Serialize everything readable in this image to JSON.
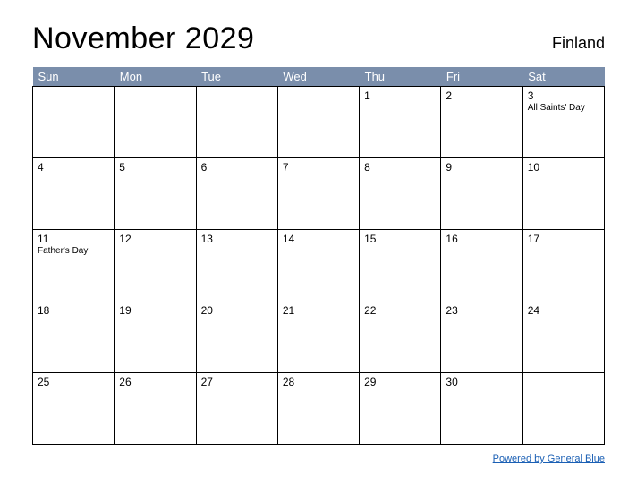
{
  "header": {
    "title": "November 2029",
    "region": "Finland"
  },
  "weekdays": [
    "Sun",
    "Mon",
    "Tue",
    "Wed",
    "Thu",
    "Fri",
    "Sat"
  ],
  "weeks": [
    [
      {
        "day": "",
        "event": ""
      },
      {
        "day": "",
        "event": ""
      },
      {
        "day": "",
        "event": ""
      },
      {
        "day": "",
        "event": ""
      },
      {
        "day": "1",
        "event": ""
      },
      {
        "day": "2",
        "event": ""
      },
      {
        "day": "3",
        "event": "All Saints' Day"
      }
    ],
    [
      {
        "day": "4",
        "event": ""
      },
      {
        "day": "5",
        "event": ""
      },
      {
        "day": "6",
        "event": ""
      },
      {
        "day": "7",
        "event": ""
      },
      {
        "day": "8",
        "event": ""
      },
      {
        "day": "9",
        "event": ""
      },
      {
        "day": "10",
        "event": ""
      }
    ],
    [
      {
        "day": "11",
        "event": "Father's Day"
      },
      {
        "day": "12",
        "event": ""
      },
      {
        "day": "13",
        "event": ""
      },
      {
        "day": "14",
        "event": ""
      },
      {
        "day": "15",
        "event": ""
      },
      {
        "day": "16",
        "event": ""
      },
      {
        "day": "17",
        "event": ""
      }
    ],
    [
      {
        "day": "18",
        "event": ""
      },
      {
        "day": "19",
        "event": ""
      },
      {
        "day": "20",
        "event": ""
      },
      {
        "day": "21",
        "event": ""
      },
      {
        "day": "22",
        "event": ""
      },
      {
        "day": "23",
        "event": ""
      },
      {
        "day": "24",
        "event": ""
      }
    ],
    [
      {
        "day": "25",
        "event": ""
      },
      {
        "day": "26",
        "event": ""
      },
      {
        "day": "27",
        "event": ""
      },
      {
        "day": "28",
        "event": ""
      },
      {
        "day": "29",
        "event": ""
      },
      {
        "day": "30",
        "event": ""
      },
      {
        "day": "",
        "event": ""
      }
    ]
  ],
  "footer": {
    "credit": "Powered by General Blue"
  }
}
